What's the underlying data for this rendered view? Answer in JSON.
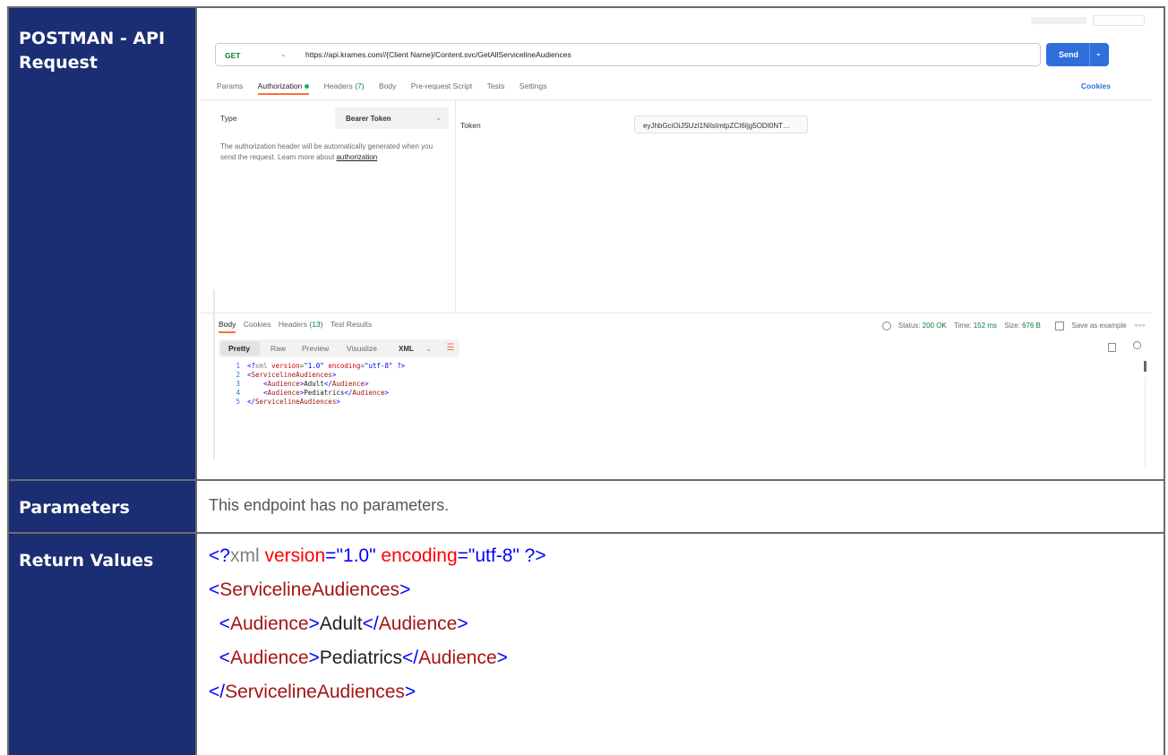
{
  "labels": {
    "postman": "POSTMAN - API Request",
    "parameters": "Parameters",
    "return_values": "Return Values"
  },
  "postman": {
    "method": "GET",
    "url": "https://api.krames.com//{Client Name}/Content.svc/GetAllServicelineAudiences",
    "send_label": "Send",
    "tabs": {
      "params": "Params",
      "authorization": "Authorization",
      "headers": "Headers",
      "headers_count": "(7)",
      "body": "Body",
      "pre_request": "Pre-request Script",
      "tests": "Tests",
      "settings": "Settings"
    },
    "cookies_link": "Cookies",
    "auth": {
      "type_label": "Type",
      "type_value": "Bearer Token",
      "help_text": "The authorization header will be automatically generated when you send the request. Learn more about",
      "help_link": "authorization",
      "token_label": "Token",
      "token_value": "eyJhbGciOiJSUzI1NiIsImtpZCI6Ijg5ODI0NT…"
    },
    "response": {
      "tabs": {
        "body": "Body",
        "cookies": "Cookies",
        "headers": "Headers",
        "headers_count": "(13)",
        "test_results": "Test Results"
      },
      "status_label": "Status:",
      "status_value": "200 OK",
      "time_label": "Time:",
      "time_value": "152 ms",
      "size_label": "Size:",
      "size_value": "676 B",
      "save_example": "Save as example",
      "view_modes": [
        "Pretty",
        "Raw",
        "Preview",
        "Visualize"
      ],
      "format": "XML",
      "code_lines": [
        {
          "num": "1"
        },
        {
          "num": "2"
        },
        {
          "num": "3"
        },
        {
          "num": "4"
        },
        {
          "num": "5"
        }
      ]
    }
  },
  "parameters_text": "This endpoint has no parameters.",
  "return_xml": {
    "decl_open": "<?",
    "decl_xml": "xml",
    "attr_version": "version",
    "val_version": "\"1.0\"",
    "attr_encoding": "encoding",
    "val_encoding": "\"utf-8\"",
    "decl_close": " ?>",
    "root_name": "ServicelineAudiences",
    "child_name": "Audience",
    "child1": "Adult",
    "child2": "Pediatrics"
  },
  "colors": {
    "label_bg": "#1b2e73",
    "send_button": "#2f6fdb",
    "status_ok": "#0a7c3a",
    "active_tab_underline": "#ff6c37"
  }
}
